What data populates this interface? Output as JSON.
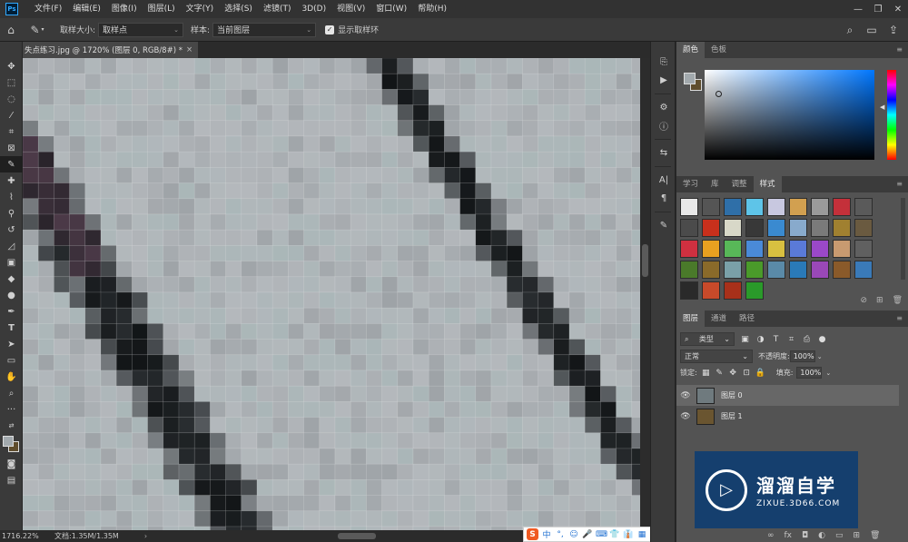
{
  "app": {
    "logo_text": "Ps"
  },
  "menubar": {
    "items": [
      "文件(F)",
      "编辑(E)",
      "图像(I)",
      "图层(L)",
      "文字(Y)",
      "选择(S)",
      "滤镜(T)",
      "3D(D)",
      "视图(V)",
      "窗口(W)",
      "帮助(H)"
    ]
  },
  "window_controls": {
    "minimize": "—",
    "restore": "❐",
    "close": "✕"
  },
  "options_bar": {
    "home_icon": "home-icon",
    "tool_icon": "eyedropper-icon",
    "sample_size_label": "取样大小:",
    "sample_size_value": "取样点",
    "sample_label": "样本:",
    "sample_value": "当前图层",
    "show_ring_label": "显示取样环",
    "show_ring_checked": true
  },
  "document": {
    "tab_title": "失点练习.jpg @ 1720% (图层 0, RGB/8#) *",
    "close": "×",
    "pixel_colors": {
      "light": "#b4b8bc",
      "mid": "#9ea3a7",
      "teal": "#a7b6b7",
      "dark": "#2a2e31",
      "darkest": "#121517",
      "purple": "#4c3a48"
    }
  },
  "statusbar": {
    "zoom": "1716.22%",
    "doc_size": "文档:1.35M/1.35M",
    "arrow": "›"
  },
  "ime_bar": {
    "logo": "S",
    "items": [
      "中",
      "°,",
      "☺",
      "🎤",
      "⌨",
      "👕",
      "👔",
      "▦"
    ]
  },
  "color_panel": {
    "tabs": [
      "颜色",
      "色板"
    ],
    "active_tab": "颜色",
    "foreground": "#a2a9ad",
    "background": "#5f4d2d"
  },
  "styles_panel": {
    "tabs": [
      "学习",
      "库",
      "调整",
      "样式"
    ],
    "active_tab": "样式",
    "swatches": [
      "#e8e8e8",
      "#555555",
      "#2f6fa8",
      "#5ec4e8",
      "#c8c8e0",
      "#d2a050",
      "#9a9a9a",
      "#c4303a",
      "#5a5a5a",
      "#4b4b4b",
      "#c8301c",
      "#d8d8c8",
      "#383838",
      "#3a8ad0",
      "#88aacc",
      "#7a7a7a",
      "#a08030",
      "#6a5a40",
      "#d03040",
      "#e8a020",
      "#58b858",
      "#4a8ad8",
      "#d8c040",
      "#5a7ad8",
      "#9a48c8",
      "#c89a70",
      "#606060",
      "#4a7a2a",
      "#8a6a2a",
      "#7aa0a8",
      "#4a9a2a",
      "#5a8aa8",
      "#2a7ab8",
      "#9a48b8",
      "#8a5a2a",
      "#3a7ab8",
      "#2a2a2a",
      "#c84a2a",
      "#a8301a",
      "#2a9a2a"
    ]
  },
  "layers_panel": {
    "tabs": [
      "图层",
      "通道",
      "路径"
    ],
    "active_tab": "图层",
    "filter_label": "类型",
    "blend_mode": "正常",
    "opacity_label": "不透明度:",
    "opacity_value": "100%",
    "lock_label": "锁定:",
    "fill_label": "填充:",
    "fill_value": "100%",
    "layers": [
      {
        "name": "图层 0",
        "selected": true,
        "thumb": "#6f7a7e"
      },
      {
        "name": "图层 1",
        "selected": false,
        "thumb": "#6a5530"
      }
    ]
  },
  "watermark": {
    "title": "溜溜自学",
    "url": "ZIXUE.3D66.COM"
  }
}
